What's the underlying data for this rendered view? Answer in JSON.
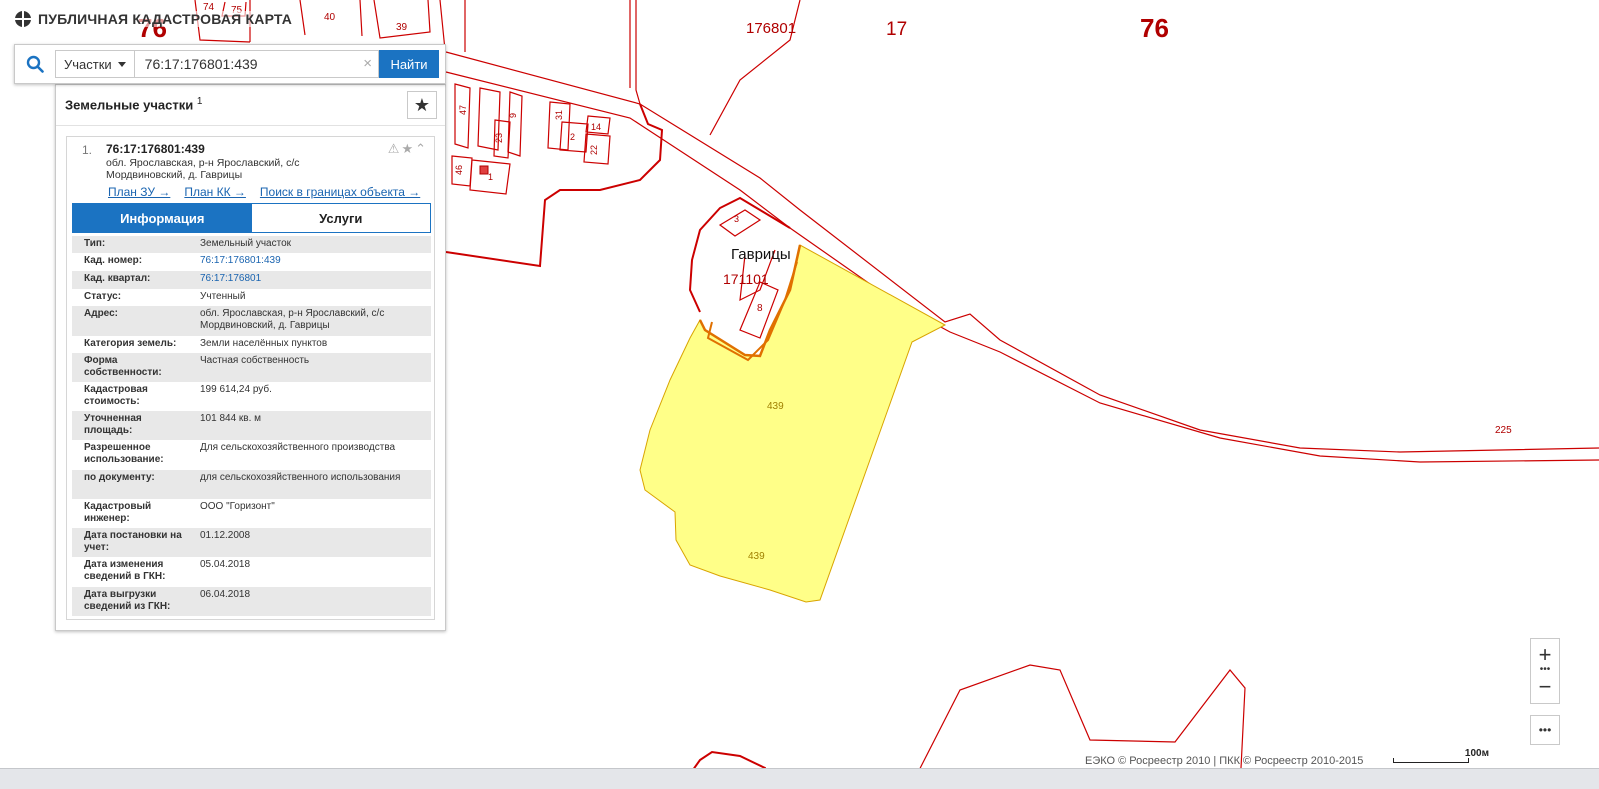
{
  "app": {
    "title": "ПУБЛИЧНАЯ КАДАСТРОВАЯ КАРТА"
  },
  "search": {
    "type_selected": "Участки",
    "query": "76:17:176801:439",
    "button_label": "Найти"
  },
  "panel": {
    "title": "Земельные участки",
    "count": "1",
    "result": {
      "index": "1.",
      "cad_number": "76:17:176801:439",
      "address": "обл. Ярославская, р-н Ярославский, с/с Мордвиновский, д. Гаврицы",
      "links": [
        "План ЗУ →",
        "План КК →",
        "Поиск в границах объекта →"
      ]
    },
    "tabs": [
      "Информация",
      "Услуги"
    ],
    "info": [
      {
        "label": "Тип:",
        "value": "Земельный участок"
      },
      {
        "label": "Кад. номер:",
        "value": "76:17:176801:439"
      },
      {
        "label": "Кад. квартал:",
        "value": "76:17:176801"
      },
      {
        "label": "Статус:",
        "value": "Учтенный"
      },
      {
        "label": "Адрес:",
        "value": "обл. Ярославская, р-н Ярославский, с/с Мордвиновский, д. Гаврицы"
      },
      {
        "label": "Категория земель:",
        "value": "Земли населённых пунктов"
      },
      {
        "label": "Форма собственности:",
        "value": "Частная собственность"
      },
      {
        "label": "Кадастровая стоимость:",
        "value": "199 614,24 руб."
      },
      {
        "label": "Уточненная площадь:",
        "value": "101 844 кв. м"
      },
      {
        "label": "Разрешенное использование:",
        "value": "Для сельскохозяйственного производства"
      },
      {
        "label": "по документу:",
        "value": "для сельскохозяйственного использования"
      },
      {
        "label": "Кадастровый инженер:",
        "value": "ООО \"Горизонт\""
      },
      {
        "label": "Дата постановки на учет:",
        "value": "01.12.2008"
      },
      {
        "label": "Дата изменения сведений в ГКН:",
        "value": "05.04.2018"
      },
      {
        "label": "Дата выгрузки сведений из ГКН:",
        "value": "06.04.2018"
      }
    ]
  },
  "map": {
    "region_label": "76",
    "district_label": "17",
    "quarter_label": "176801",
    "region_label_small": "76",
    "village_name": "Гаврицы",
    "village_quarter": "171101",
    "parcel_label": "439",
    "road_label": "225",
    "parcel_numbers": [
      "74",
      "75",
      "40",
      "39",
      "47",
      "23",
      "9",
      "46",
      "1",
      "31",
      "2",
      "14",
      "22",
      "3",
      "8"
    ],
    "colors": {
      "boundary": "#cc0000",
      "parcel_fill": "#ffff88",
      "parcel_stroke": "#d9a400",
      "selected_outline": "#e07000"
    }
  },
  "controls": {
    "zoom_in": "+",
    "zoom_dots": "•••",
    "zoom_out": "−",
    "more": "•••",
    "copyright": "ЕЭКО © Росреестр 2010 | ПКК © Росреестр 2010-2015",
    "scale": "100м"
  }
}
